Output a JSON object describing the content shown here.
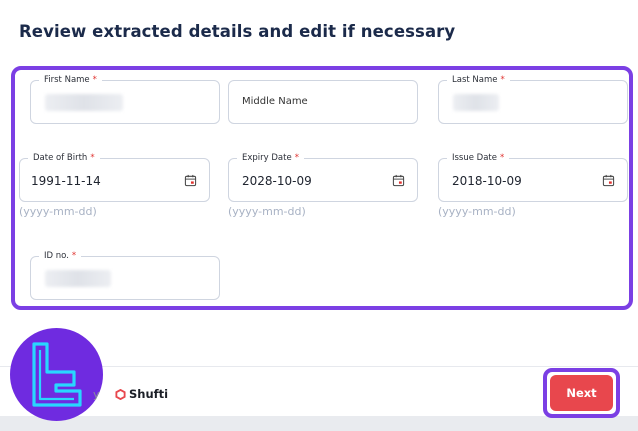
{
  "page": {
    "title": "Review extracted details and edit if necessary"
  },
  "fields": {
    "first_name": {
      "label": "First Name",
      "required": "*"
    },
    "middle_name": {
      "placeholder": "Middle Name"
    },
    "last_name": {
      "label": "Last Name",
      "required": "*"
    },
    "dob": {
      "label": "Date of Birth",
      "required": "*",
      "value": "1991-11-14",
      "hint": "(yyyy-mm-dd)"
    },
    "expiry": {
      "label": "Expiry Date",
      "required": "*",
      "value": "2028-10-09",
      "hint": "(yyyy-mm-dd)"
    },
    "issue": {
      "label": "Issue Date",
      "required": "*",
      "value": "2018-10-09",
      "hint": "(yyyy-mm-dd)"
    },
    "id_no": {
      "label": "ID no.",
      "required": "*"
    }
  },
  "footer": {
    "powered_by": "y",
    "brand": "Shufti",
    "next_label": "Next"
  },
  "colors": {
    "accent": "#7b3fe4",
    "next_button": "#e8474d",
    "required": "#e0322f",
    "logo_cyan": "#28d7ff"
  }
}
